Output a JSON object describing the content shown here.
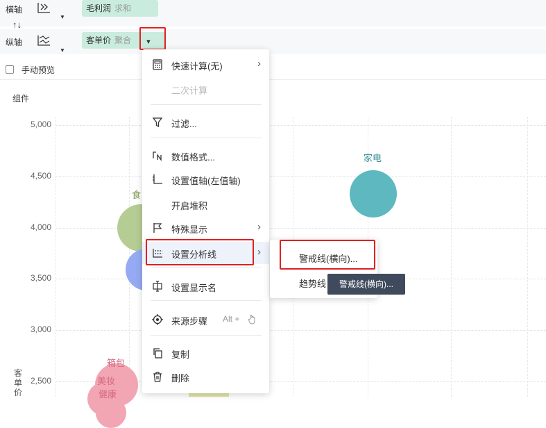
{
  "axes": {
    "x_label": "横轴",
    "y_label": "纵轴",
    "swap_icon": "↑↓",
    "x_field": {
      "name": "毛利润",
      "agg": "求和"
    },
    "y_field": {
      "name": "客单价",
      "agg": "聚合"
    }
  },
  "manual_preview": {
    "label": "手动预览",
    "checked": false
  },
  "chart": {
    "component_label": "组件",
    "y_axis_title": "客单价",
    "yticks": [
      "5,000",
      "4,500",
      "4,000",
      "3,500",
      "3,000",
      "2,500"
    ],
    "bubble_labels": [
      "家电",
      "食",
      "箱包",
      "美妆",
      "健康"
    ]
  },
  "chart_data": {
    "type": "scatter",
    "ylabel": "客单价",
    "ylim": [
      2500,
      5000
    ],
    "yticks": [
      5000,
      4500,
      4000,
      3500,
      3000,
      2500
    ],
    "points": [
      {
        "label": "家电",
        "y": 4330,
        "color": "#5db8bf"
      },
      {
        "label": "食",
        "y": 4000,
        "color": "#b5cc94"
      },
      {
        "label": "",
        "y": 3590,
        "color": "#95aaf2"
      },
      {
        "label": "箱包",
        "y": 2500,
        "color": "#f2a5b3"
      },
      {
        "label": "美妆",
        "y": 2500,
        "color": "#f2a5b3"
      },
      {
        "label": "健康",
        "y": 2500,
        "color": "#f2a5b3"
      }
    ]
  },
  "menu": {
    "items": [
      {
        "label": "快速计算(无)",
        "icon": "calculator-icon",
        "arrow": true,
        "disabled": false
      },
      {
        "label": "二次计算",
        "icon": "",
        "arrow": false,
        "disabled": true
      },
      {
        "label": "过滤...",
        "icon": "filter-icon",
        "arrow": false,
        "disabled": false
      },
      {
        "label": "数值格式...",
        "icon": "number-format-icon",
        "arrow": false,
        "disabled": false
      },
      {
        "label": "设置值轴(左值轴)",
        "icon": "value-axis-icon",
        "arrow": false,
        "disabled": false
      },
      {
        "label": "开启堆积",
        "icon": "",
        "arrow": false,
        "disabled": false
      },
      {
        "label": "特殊显示",
        "icon": "flag-icon",
        "arrow": true,
        "disabled": false
      },
      {
        "label": "设置分析线",
        "icon": "analysis-line-icon",
        "arrow": true,
        "disabled": false
      },
      {
        "label": "设置显示名",
        "icon": "display-name-icon",
        "arrow": false,
        "disabled": false
      },
      {
        "label": "来源步骤",
        "icon": "source-step-icon",
        "arrow": false,
        "disabled": false,
        "shortcut": "Alt +"
      },
      {
        "label": "复制",
        "icon": "copy-icon",
        "arrow": false,
        "disabled": false
      },
      {
        "label": "删除",
        "icon": "trash-icon",
        "arrow": false,
        "disabled": false
      }
    ]
  },
  "submenu": {
    "items": [
      {
        "label": "警戒线(横向)..."
      },
      {
        "label": "趋势线"
      }
    ]
  },
  "tooltip": {
    "text": "警戒线(横向)..."
  },
  "colors": {
    "pill": "#c9ecdf",
    "highlight": "#e02020",
    "tooltip_bg": "#3f4a5c"
  }
}
